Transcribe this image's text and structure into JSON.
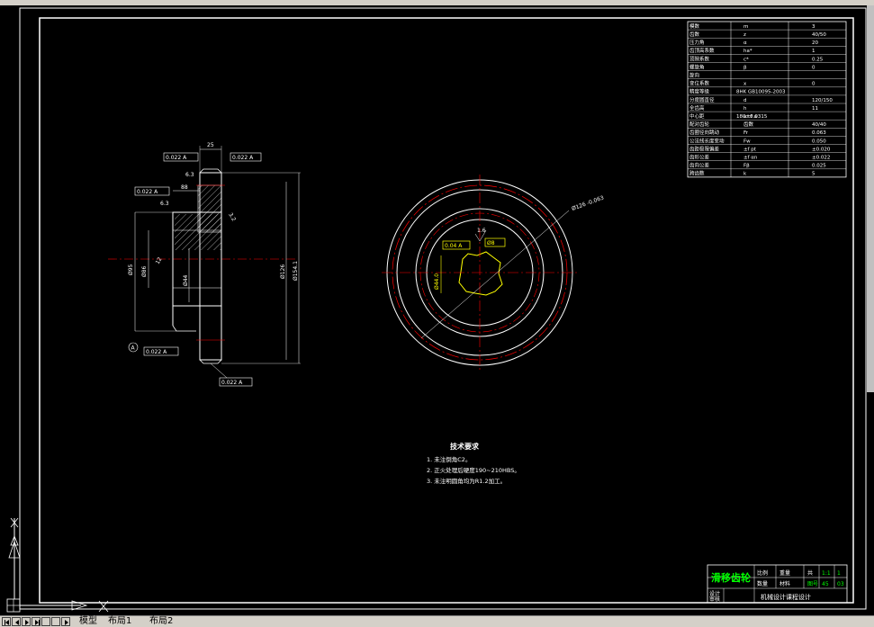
{
  "params_table": {
    "rows": [
      {
        "name": "模数",
        "sym": "m",
        "val": "3"
      },
      {
        "name": "齿数",
        "sym": "z",
        "val": "40/50"
      },
      {
        "name": "压力角",
        "sym": "α",
        "val": "20"
      },
      {
        "name": "齿顶高系数",
        "sym": "ha*",
        "val": "1"
      },
      {
        "name": "顶隙系数",
        "sym": "c*",
        "val": "0.25"
      },
      {
        "name": "螺旋角",
        "sym": "β",
        "val": "0"
      },
      {
        "name": "旋向",
        "sym": "",
        "val": ""
      },
      {
        "name": "变位系数",
        "sym": "x",
        "val": "0"
      },
      {
        "name": "精度等级",
        "sym": "",
        "val": "8HK GB10095-2003"
      },
      {
        "name": "分度圆直径",
        "sym": "d",
        "val": "120/150"
      },
      {
        "name": "全齿高",
        "sym": "h",
        "val": "11"
      },
      {
        "name": "中心距",
        "sym": "a±f a",
        "val": "180±0.0315"
      },
      {
        "name": "配对齿轮",
        "sym": "齿数",
        "val": "40/40"
      },
      {
        "name": "齿圈径向跳动",
        "sym": "Fr",
        "val": "0.063"
      },
      {
        "name": "公法线长度变动",
        "sym": "Fw",
        "val": "0.050"
      },
      {
        "name": "齿距极限偏差",
        "sym": "±f pt",
        "val": "±0.020"
      },
      {
        "name": "齿形公差",
        "sym": "±f αn",
        "val": "±0.022"
      },
      {
        "name": "齿向公差",
        "sym": "Fβ",
        "val": "0.025"
      },
      {
        "name": "跨齿数",
        "sym": "k",
        "val": "5"
      }
    ]
  },
  "side_view": {
    "tol_top_left": "0.022 A",
    "tol_top_right": "0.022 A",
    "tol_left_mid": "0.022 A",
    "tol_bottom_left": "0.022 A",
    "tol_bottom": "0.022 A",
    "dim_width": "25",
    "dim_hub": "88",
    "dim_chamfer1": "6.3",
    "dim_chamfer2": "6.3",
    "dim_surface": "3.2",
    "dim_surface2": "12",
    "dim_bore": "Ø95",
    "dim_keyway": "Ø86",
    "dim_tip": "Ø126",
    "dim_outer": "Ø154.1",
    "dim_inner": "Ø44",
    "datum": "A"
  },
  "front_view": {
    "dim_tip": "Ø126 -0.063",
    "tol_frame": "0.04 A",
    "dim_spline": "Ø8",
    "dim_roughness": "1.6",
    "dim_bore": "Ø44.0"
  },
  "tech_req": {
    "title": "技术要求",
    "items": [
      "1. 未注倒角C2。",
      "2. 正火处理后硬度190~210HBS。",
      "3. 未注明圆角均为R1.2加工。"
    ]
  },
  "title_block": {
    "part_name": "滑移齿轮",
    "scale_label": "比例",
    "scale": "1:1",
    "qty_label": "数量",
    "qty": "1",
    "material": "材料",
    "weight_label": "重量",
    "sheet": "共",
    "drawing_no": "图号",
    "design_label": "设计",
    "design_val": "",
    "check_label": "审核",
    "check_val": "",
    "mat_value": "45",
    "school": "机械设计课程设计",
    "draw_no_value": "03"
  },
  "tabs": {
    "model": "模型",
    "layout1": "布局1",
    "layout2": "布局2"
  },
  "colors": {
    "background": "#000000",
    "line": "#ffffff",
    "center": "#ff0000",
    "dimension": "#ffff00",
    "accent": "#00ff00"
  }
}
